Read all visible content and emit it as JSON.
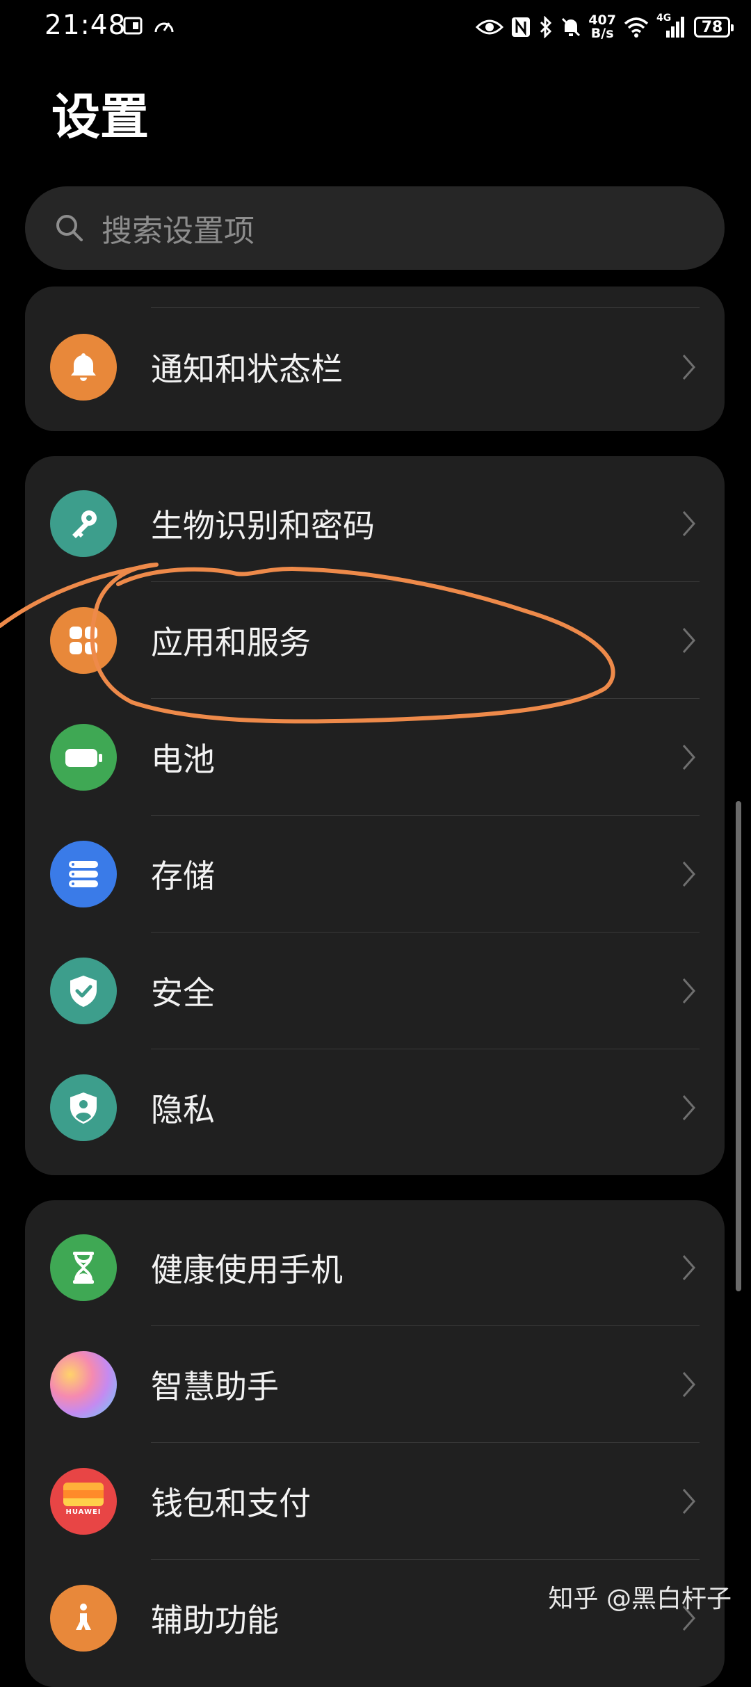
{
  "status_bar": {
    "time": "21:48",
    "net_speed_value": "407",
    "net_speed_unit": "B/s",
    "cell_type": "4G",
    "battery": "78"
  },
  "page": {
    "title": "设置"
  },
  "search": {
    "placeholder": "搜索设置项"
  },
  "groups": [
    {
      "items": [
        {
          "label": "通知和状态栏",
          "icon": "bell-icon",
          "color": "#E8883A"
        }
      ]
    },
    {
      "items": [
        {
          "label": "生物识别和密码",
          "icon": "key-icon",
          "color": "#3D9E8C"
        },
        {
          "label": "应用和服务",
          "icon": "apps-icon",
          "color": "#E8883A"
        },
        {
          "label": "电池",
          "icon": "battery-icon",
          "color": "#3FA854"
        },
        {
          "label": "存储",
          "icon": "storage-icon",
          "color": "#3A7BE8"
        },
        {
          "label": "安全",
          "icon": "shield-check-icon",
          "color": "#3D9E8C"
        },
        {
          "label": "隐私",
          "icon": "privacy-icon",
          "color": "#3D9E8C"
        }
      ]
    },
    {
      "items": [
        {
          "label": "健康使用手机",
          "icon": "hourglass-icon",
          "color": "#3FA854"
        },
        {
          "label": "智慧助手",
          "icon": "assistant-icon",
          "color": "#D88AE0"
        },
        {
          "label": "钱包和支付",
          "icon": "wallet-icon",
          "color": "#E84545"
        },
        {
          "label": "辅助功能",
          "icon": "accessibility-icon",
          "color": "#E8883A"
        }
      ]
    }
  ],
  "wallet_brand": "HUAWEI",
  "annotation": {
    "color": "#EE8A4A"
  },
  "watermark": "知乎 @黑白杆子"
}
